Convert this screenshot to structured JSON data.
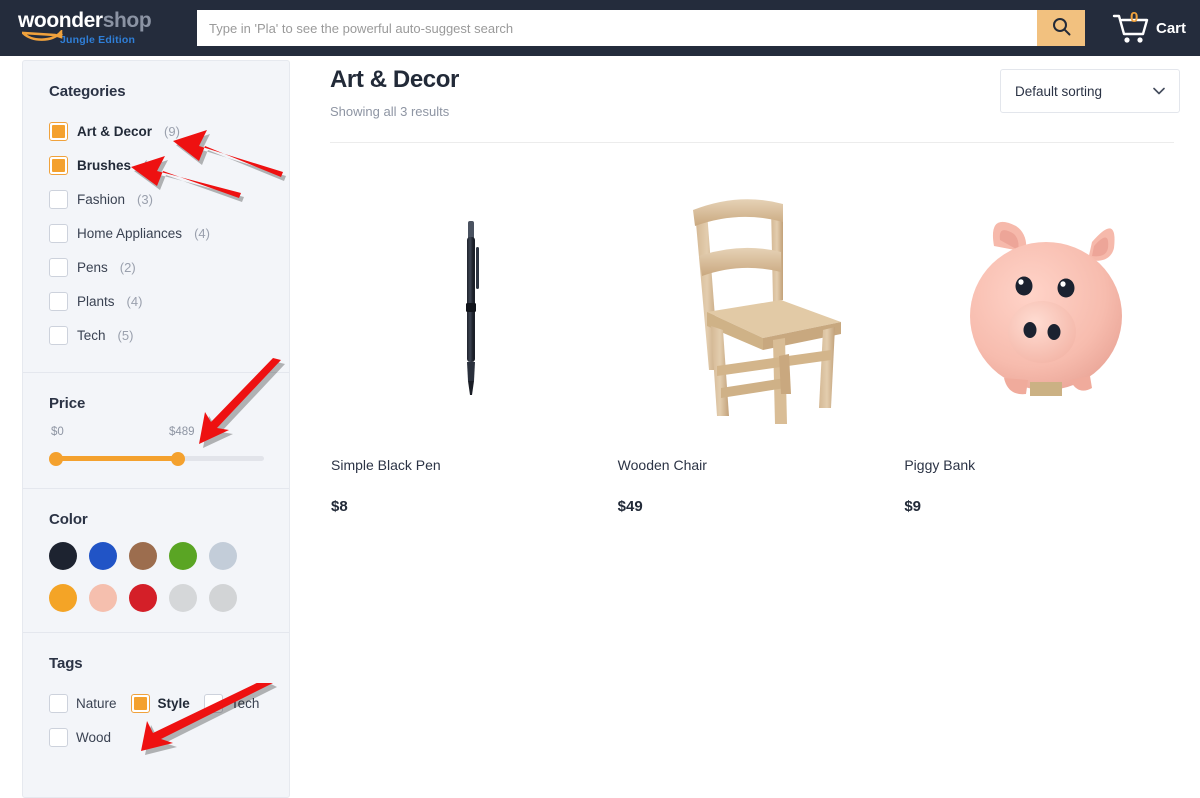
{
  "header": {
    "logo": {
      "word_primary": "woonder",
      "word_secondary": "shop",
      "subtitle": "Jungle Edition",
      "swoosh_color": "#f0a23c"
    },
    "search": {
      "placeholder": "Type in 'Pla' to see the powerful auto-suggest search",
      "value": "",
      "button_icon": "search-icon",
      "button_color": "#f2c17f"
    },
    "cart": {
      "icon": "shopping-cart-icon",
      "count": "0",
      "label": "Cart",
      "count_color": "#f0a23c"
    },
    "background": "#242c3c"
  },
  "sidebar": {
    "categories": {
      "title": "Categories",
      "items": [
        {
          "label": "Art & Decor",
          "count": "(9)",
          "checked": true
        },
        {
          "label": "Brushes",
          "count": "(3)",
          "checked": true
        },
        {
          "label": "Fashion",
          "count": "(3)",
          "checked": false
        },
        {
          "label": "Home Appliances",
          "count": "(4)",
          "checked": false
        },
        {
          "label": "Pens",
          "count": "(2)",
          "checked": false
        },
        {
          "label": "Plants",
          "count": "(4)",
          "checked": false
        },
        {
          "label": "Tech",
          "count": "(5)",
          "checked": false
        }
      ]
    },
    "price": {
      "title": "Price",
      "min_label": "$0",
      "max_label": "$489",
      "fill_color": "#f4a12e"
    },
    "color": {
      "title": "Color",
      "swatches": [
        {
          "name": "black",
          "hex": "#1d2330"
        },
        {
          "name": "blue",
          "hex": "#2154c6"
        },
        {
          "name": "brown",
          "hex": "#9c6d4e"
        },
        {
          "name": "green",
          "hex": "#5aa524"
        },
        {
          "name": "light-blue-gray",
          "hex": "#c3cdd9"
        },
        {
          "name": "orange",
          "hex": "#f4a426"
        },
        {
          "name": "pink",
          "hex": "#f5bfae"
        },
        {
          "name": "red",
          "hex": "#d41f28"
        },
        {
          "name": "light-gray",
          "hex": "#d5d7d9"
        },
        {
          "name": "gray",
          "hex": "#d2d4d6"
        }
      ]
    },
    "tags": {
      "title": "Tags",
      "items": [
        {
          "label": "Nature",
          "checked": false
        },
        {
          "label": "Style",
          "checked": true
        },
        {
          "label": "Tech",
          "checked": false
        },
        {
          "label": "Wood",
          "checked": false
        }
      ]
    }
  },
  "main": {
    "title": "Art & Decor",
    "results_text": "Showing all 3 results",
    "sorting": {
      "selected": "Default sorting",
      "icon": "chevron-down-icon"
    },
    "products": [
      {
        "name": "Simple Black Pen",
        "price": "$8",
        "image": "black-pen-image"
      },
      {
        "name": "Wooden Chair",
        "price": "$49",
        "image": "wooden-chair-image"
      },
      {
        "name": "Piggy Bank",
        "price": "$9",
        "image": "piggy-bank-image"
      }
    ]
  },
  "annotations": {
    "arrow_color": "#ee1111",
    "arrows": [
      {
        "name": "arrow-to-art-decor-checkbox",
        "points_to": "Art & Decor"
      },
      {
        "name": "arrow-to-brushes-checkbox",
        "points_to": "Brushes"
      },
      {
        "name": "arrow-to-price-max",
        "points_to": "$489"
      },
      {
        "name": "arrow-to-style-tag",
        "points_to": "Style"
      }
    ]
  }
}
